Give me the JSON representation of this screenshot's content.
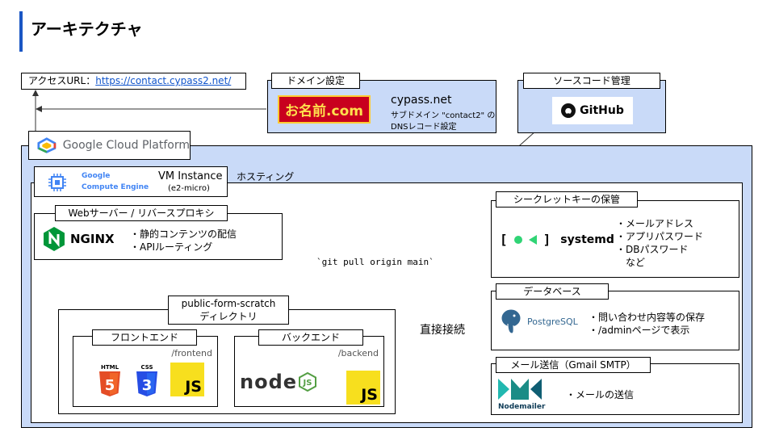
{
  "title": "アーキテクチャ",
  "access": {
    "label": "アクセスURL：",
    "url": "https://contact.cypass2.net/"
  },
  "domain": {
    "tag": "ドメイン設定",
    "logo_text": "お名前.com",
    "name": "cypass.net",
    "desc_line1": "サブドメイン \"contact2\" の",
    "desc_line2": "DNSレコード設定"
  },
  "source": {
    "tag": "ソースコード管理",
    "logo_text": "GitHub"
  },
  "gcp": {
    "logo_text": "Google Cloud Platform"
  },
  "vm": {
    "gce_line1": "Google",
    "gce_line2": "Compute Engine",
    "title": "VM Instance",
    "subtitle": "(e2-micro)",
    "hosting": "ホスティング"
  },
  "web": {
    "tag": "Webサーバー / リバースプロキシ",
    "logo_text": "NGINX",
    "bullets": [
      "・静的コンテンツの配信",
      "・APIルーティング"
    ]
  },
  "git_cmd": "`git pull origin main`",
  "direct": "直接接続",
  "project": {
    "tag_line1": "public-form-scratch",
    "tag_line2": "ディレクトリ",
    "frontend": {
      "tag": "フロントエンド",
      "path": "/frontend",
      "html": "HTML",
      "css": "CSS",
      "js": "JS"
    },
    "backend": {
      "tag": "バックエンド",
      "path": "/backend",
      "node": "node",
      "js": "JS"
    }
  },
  "secrets": {
    "tag": "シークレットキーの保管",
    "logo_text": "systemd",
    "bullets": [
      "・メールアドレス",
      "・アプリパスワード",
      "・DBパスワード",
      "　など"
    ]
  },
  "database": {
    "tag": "データベース",
    "logo_text": "PostgreSQL",
    "bullets": [
      "・問い合わせ内容等の保存",
      "・/adminページで表示"
    ]
  },
  "mail": {
    "tag": "メール送信（Gmail SMTP）",
    "logo_text": "Nodemailer",
    "bullets": [
      "・メールの送信"
    ]
  },
  "colors": {
    "accent": "#1a56c4",
    "container": "#c9daf8",
    "onamae_red": "#c8001e",
    "js_yellow": "#f7df1e",
    "nginx_green": "#009639"
  }
}
